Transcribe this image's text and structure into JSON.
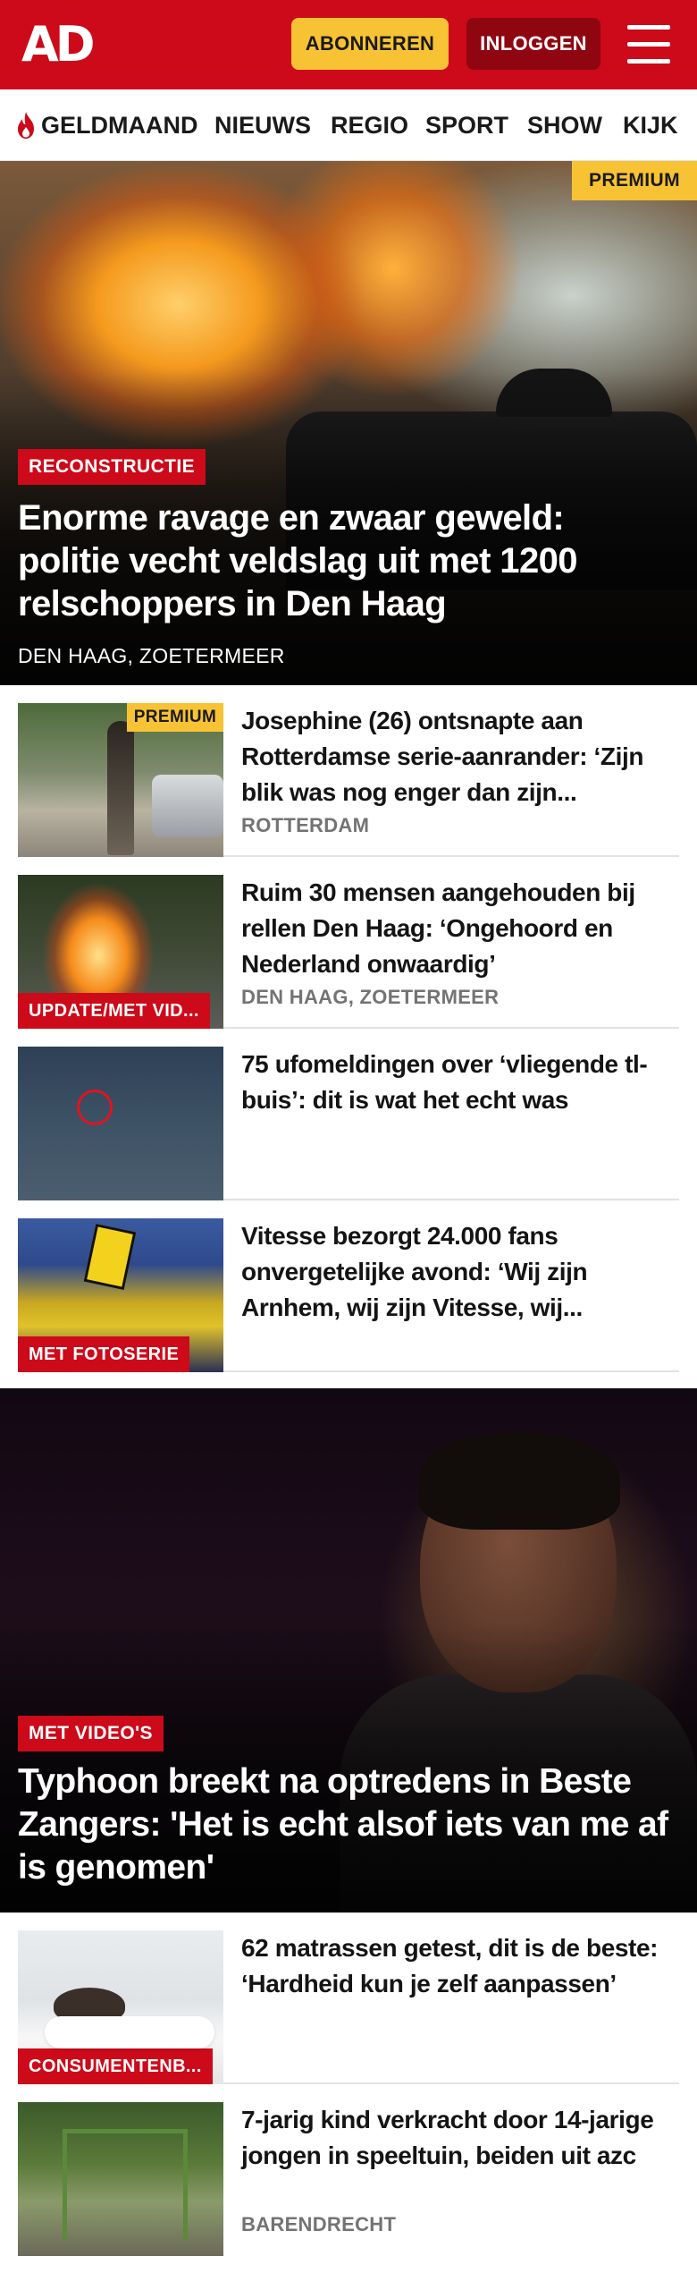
{
  "header": {
    "logo": "AD",
    "subscribe_label": "ABONNEREN",
    "login_label": "INLOGGEN",
    "brand_color": "#cc0a1a",
    "accent_color": "#f7c334",
    "menu_icon": "hamburger-menu-icon"
  },
  "nav": {
    "items": [
      {
        "label": "GELDMAAND",
        "icon": "flame-icon"
      },
      {
        "label": "NIEUWS"
      },
      {
        "label": "REGIO"
      },
      {
        "label": "SPORT"
      },
      {
        "label": "SHOW"
      },
      {
        "label": "KIJK"
      }
    ]
  },
  "hero": {
    "badge": "PREMIUM",
    "tag": "RECONSTRUCTIE",
    "title": "Enorme ravage en zwaar geweld: politie vecht veldslag uit met 1200 relschoppers in Den Haag",
    "location": "DEN HAAG, ZOETERMEER"
  },
  "articles": [
    {
      "badge": "PREMIUM",
      "title": "Josephine (26) ontsnapte aan Rotterdamse serie-aanrander: ‘Zijn blik was nog enger dan zijn...",
      "location": "ROTTERDAM"
    },
    {
      "tag": "UPDATE/MET VID...",
      "title": "Ruim 30 mensen aangehouden bij rellen Den Haag: ‘Ongehoord en Nederland onwaardig’",
      "location": "DEN HAAG, ZOETERMEER"
    },
    {
      "title": "75 ufomeldingen over ‘vliegende tl-buis’: dit is wat het echt was"
    },
    {
      "tag": "MET FOTOSERIE",
      "title": "Vitesse bezorgt 24.000 fans onvergetelijke avond: ‘Wij zijn Arnhem, wij zijn Vitesse, wij..."
    }
  ],
  "feature": {
    "tag": "MET VIDEO'S",
    "title": "Typhoon breekt na optredens in Beste Zangers: 'Het is echt alsof iets van me af is genomen'"
  },
  "articles2": [
    {
      "tag": "CONSUMENTENB...",
      "title": "62 matrassen getest, dit is de beste: ‘Hardheid kun je zelf aanpassen’"
    },
    {
      "title": "7-jarig kind verkracht door 14-jarige jongen in speeltuin, beiden uit azc",
      "location": "BARENDRECHT"
    }
  ]
}
